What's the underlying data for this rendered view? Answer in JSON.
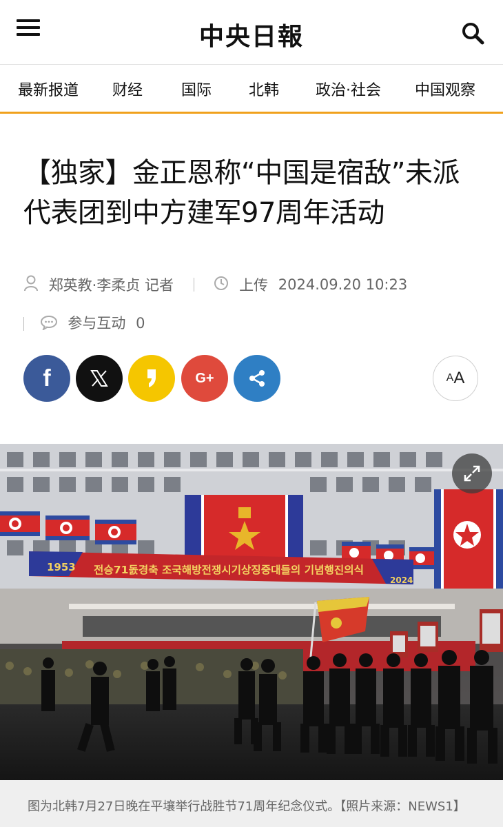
{
  "header": {
    "logo": "中央日報",
    "menu_icon": "hamburger-menu-icon",
    "search_icon": "search-icon"
  },
  "nav": {
    "items": [
      {
        "label": "最新报道"
      },
      {
        "label": "财经"
      },
      {
        "label": "国际"
      },
      {
        "label": "北韩"
      },
      {
        "label": "政治·社会"
      },
      {
        "label": "中国观察"
      }
    ],
    "accent_color": "#f0a11c"
  },
  "article": {
    "title": "【独家】金正恩称“中国是宿敌”未派代表团到中方建军97周年活动",
    "authors": "郑英教·李柔贞 记者",
    "upload_label": "上传",
    "upload_time": "2024.09.20 10:23",
    "comments_label": "参与互动",
    "comments_count": "0"
  },
  "share": {
    "buttons": [
      {
        "name": "facebook",
        "glyph": "f",
        "color": "#3b5a99"
      },
      {
        "name": "x",
        "glyph": "X",
        "color": "#111111"
      },
      {
        "name": "kakaostory",
        "glyph": "❜",
        "color": "#f5c600"
      },
      {
        "name": "google-plus",
        "glyph": "G+",
        "color": "#df4a3c"
      },
      {
        "name": "share",
        "glyph": "share",
        "color": "#2f7fc4"
      }
    ],
    "font_size_label": "AA"
  },
  "photo": {
    "banner_left_year": "1953",
    "banner_right_year": "2024",
    "banner_text": "전승71돐경축 조국해방전쟁시기상징중대들의 기념행진의식",
    "expand_icon": "expand-icon"
  },
  "caption": "图为北韩7月27日晚在平壤举行战胜节71周年纪念仪式。【照片来源：NEWS1】"
}
